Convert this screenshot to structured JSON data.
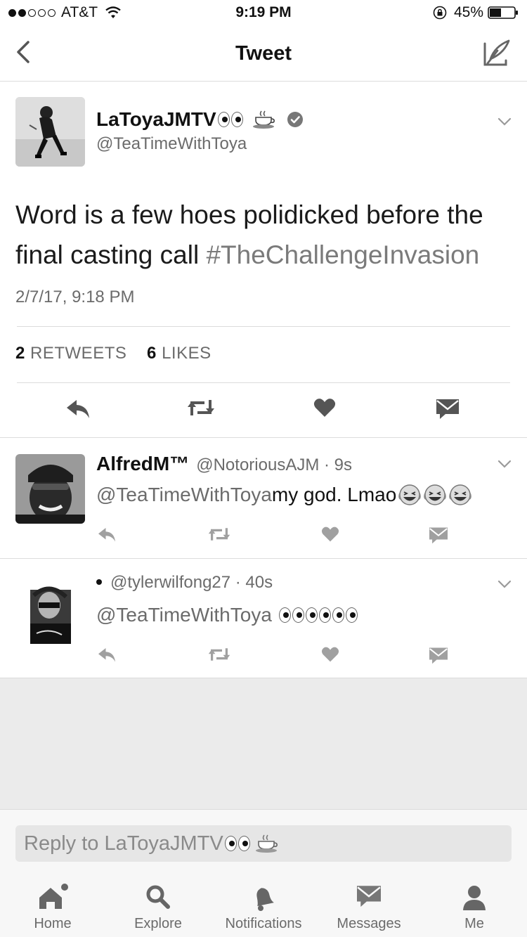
{
  "status_bar": {
    "carrier": "AT&T",
    "time": "9:19 PM",
    "battery": "45%"
  },
  "nav": {
    "title": "Tweet"
  },
  "main_tweet": {
    "author_name": "LaToyaJMTV",
    "handle": "@TeaTimeWithToya",
    "text": "Word is a few hoes polidicked before the final casting call ",
    "hashtag": "#TheChallengeInvasion",
    "date": "2/7/17, 9:18 PM",
    "retweets_count": "2",
    "retweets_label": "RETWEETS",
    "likes_count": "6",
    "likes_label": "LIKES"
  },
  "replies": [
    {
      "name": "AlfredM™",
      "handle": "@NotoriousAJM · 9s",
      "mention": "@TeaTimeWithToya",
      "text": " my god. Lmao"
    },
    {
      "name": "",
      "handle": "@tylerwilfong27 · 40s",
      "mention": "@TeaTimeWithToya",
      "text": ""
    }
  ],
  "reply_bar": {
    "placeholder": "Reply to LaToyaJMTV"
  },
  "tabs": [
    {
      "label": "Home",
      "icon": "home-icon"
    },
    {
      "label": "Explore",
      "icon": "search-icon"
    },
    {
      "label": "Notifications",
      "icon": "bell-icon"
    },
    {
      "label": "Messages",
      "icon": "envelope-icon"
    },
    {
      "label": "Me",
      "icon": "person-icon"
    }
  ],
  "colors": {
    "text": "#1a1a1a",
    "secondary_text": "#6b6b6b",
    "divider": "#dcdcdc",
    "empty_area": "#ebebeb"
  }
}
